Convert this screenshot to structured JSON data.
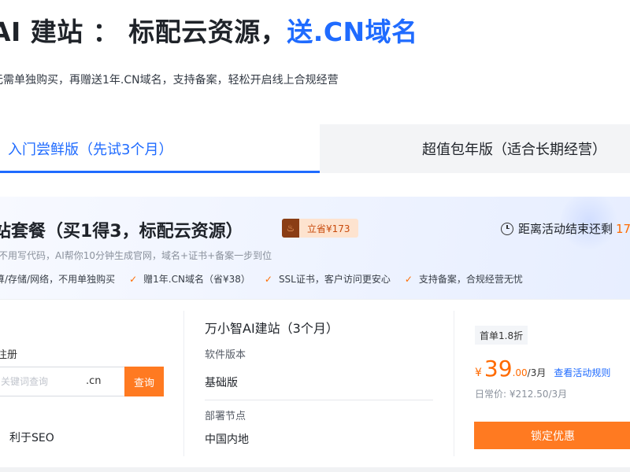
{
  "header": {
    "title_main": "AI 建站 ： 标配云资源，",
    "title_highlight": "送.CN域名",
    "subtitle": "无需单独购买，再赠送1年.CN域名，支持备案，轻松开启线上合规经营"
  },
  "tabs": [
    {
      "label": "入门尝鲜版（先试3个月）",
      "active": true
    },
    {
      "label": "超值包年版（适合长期经营）",
      "active": false
    }
  ],
  "package": {
    "title": "站套餐（买1得3，标配云资源）",
    "save_badge": "立省¥173",
    "countdown_label": "距离活动结束还剩",
    "countdown_value": "17",
    "description": "不用写代码，AI帮你10分钟生成官网，域名+证书+备案一步到位",
    "features": [
      "算/存储/网络，不用单独购买",
      "赠1年.CN域名（省¥38）",
      "SSL证书，客户访问更安心",
      "支持备案，合规经营无忧"
    ]
  },
  "domain": {
    "label": "注册",
    "placeholder": "关键词查询",
    "suffix": ".cn",
    "query_button": "查询",
    "seo_text": "利于SEO"
  },
  "product": {
    "name": "万小智AI建站（3个月）",
    "version_label": "软件版本",
    "version_value": "基础版",
    "node_label": "部署节点",
    "node_value": "中国内地"
  },
  "pricing": {
    "badge": "首单1.8折",
    "currency": "¥",
    "price_int": "39",
    "price_dec": ".00",
    "period": "/3月",
    "rules_link": "查看活动规则",
    "daily_price": "日常价: ¥212.50/3月",
    "lock_button": "锁定优惠"
  },
  "colors": {
    "accent_blue": "#1f6bff",
    "accent_orange": "#ff7a21",
    "price_orange": "#ff6a00"
  }
}
